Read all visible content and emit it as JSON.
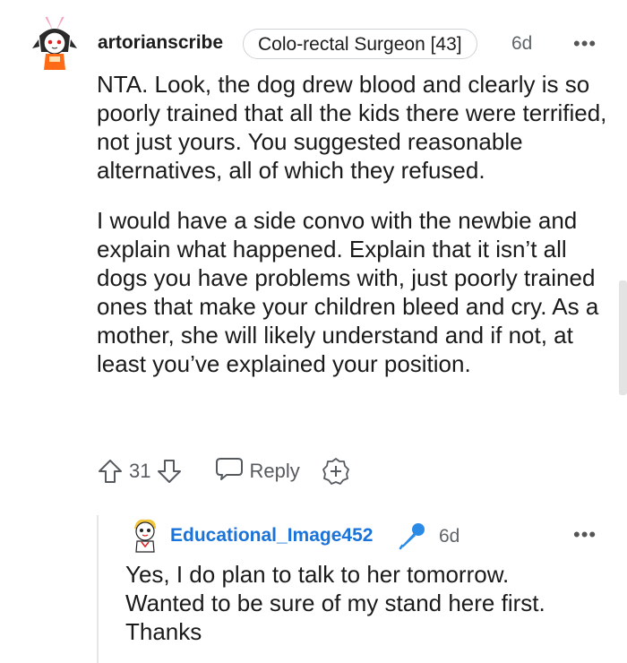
{
  "comment": {
    "username": "artorianscribe",
    "flair": "Colo-rectal Surgeon [43]",
    "time": "6d",
    "more": "•••",
    "paragraphs": [
      "NTA. Look, the dog drew blood and clearly is so poorly trained that all the kids there were terrified, not just yours. You suggested reasonable alternatives, all of which they refused.",
      "I would have a side convo with the newbie and explain what happened. Explain that it isn’t all dogs you have problems with, just poorly trained ones that make your children bleed and cry. As a mother, she will likely understand and if not, at least you’ve explained your position."
    ],
    "votes": "31",
    "reply_label": "Reply",
    "icons": {
      "upvote": "upvote-arrow-icon",
      "downvote": "downvote-arrow-icon",
      "reply": "speech-bubble-icon",
      "award": "add-award-icon"
    }
  },
  "reply": {
    "username": "Educational_Image452",
    "op_badge_icon": "microphone-icon",
    "time": "6d",
    "more": "•••",
    "text": "Yes, I do plan to talk to her tomorrow. Wanted to be sure of my stand here first. Thanks"
  },
  "colors": {
    "username_reply": "#1a73d9",
    "mic_badge": "#2a8ae6",
    "muted": "#5f6468"
  }
}
